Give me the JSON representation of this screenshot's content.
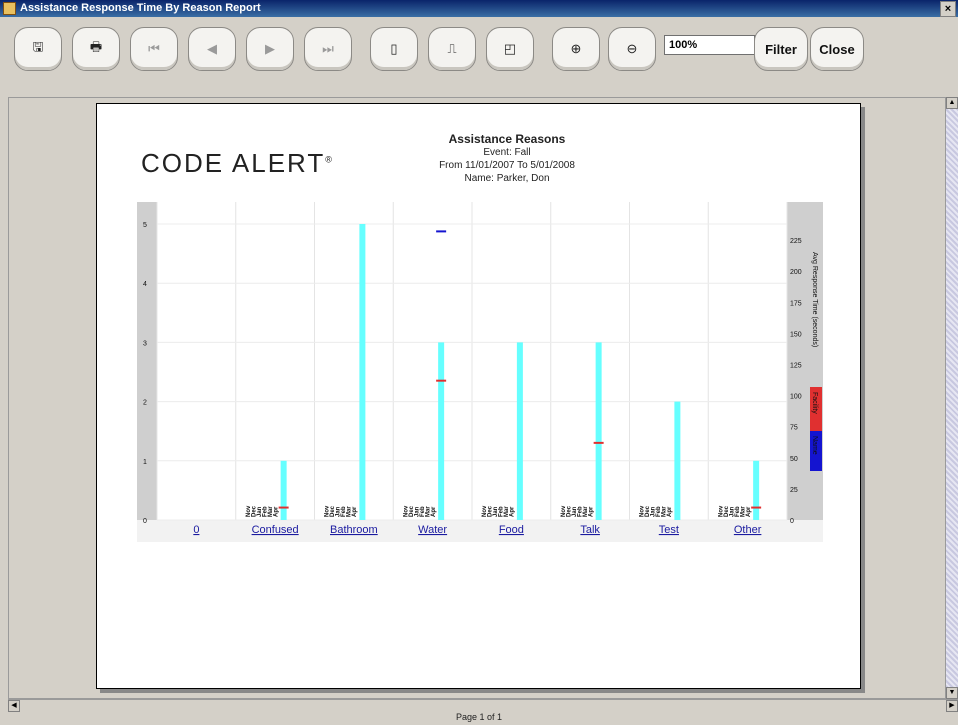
{
  "window": {
    "title": "Assistance Response Time By Reason Report",
    "close_glyph": "×"
  },
  "toolbar": {
    "buttons": [
      {
        "icon": "save-icon",
        "glyph": "🖫"
      },
      {
        "icon": "print-icon",
        "glyph": "🖶"
      },
      {
        "icon": "first-page-icon",
        "glyph": "⏮"
      },
      {
        "icon": "previous-page-icon",
        "glyph": "◀"
      },
      {
        "icon": "next-page-icon",
        "glyph": "▶"
      },
      {
        "icon": "last-page-icon",
        "glyph": "⏭"
      },
      {
        "icon": "actual-size-icon",
        "glyph": "▯"
      },
      {
        "icon": "fit-width-icon",
        "glyph": "⎍"
      },
      {
        "icon": "fit-page-icon",
        "glyph": "◰"
      },
      {
        "icon": "zoom-in-icon",
        "glyph": "⊕"
      },
      {
        "icon": "zoom-out-icon",
        "glyph": "⊖"
      }
    ],
    "zoom_value": "100%",
    "filter_label": "Filter",
    "close_label": "Close"
  },
  "report": {
    "logo": "CODE ALERT",
    "logo_mark": "®",
    "title": "Assistance Reasons",
    "event": "Event: Fall",
    "range": "From 11/01/2007 To 5/01/2008",
    "name": "Name: Parker, Don"
  },
  "chart_data": {
    "type": "bar",
    "categories": [
      "0",
      "Confused",
      "Bathroom",
      "Water",
      "Food",
      "Talk",
      "Test",
      "Other"
    ],
    "month_labels": [
      "Nov",
      "Dec",
      "Jan",
      "Feb",
      "Mar",
      "Apr"
    ],
    "count_axis": {
      "ticks": [
        "0",
        "1",
        "2",
        "3",
        "4",
        "5"
      ],
      "ylim": [
        0,
        5
      ]
    },
    "time_axis": {
      "label": "Avg Response Time (seconds)",
      "ticks": [
        "0",
        "25",
        "50",
        "75",
        "100",
        "125",
        "150",
        "175",
        "200",
        "225"
      ],
      "ylim": [
        0,
        250
      ]
    },
    "legend": [
      {
        "label": "Facility",
        "color": "#e03030"
      },
      {
        "label": "Name",
        "color": "#1414d0"
      }
    ],
    "bar_color": "#66ffff",
    "counts": [
      0,
      1,
      5,
      3,
      3,
      3,
      2,
      1
    ],
    "facility_avg": [
      null,
      10,
      null,
      112,
      null,
      62,
      null,
      10
    ],
    "name_avg": [
      null,
      null,
      null,
      232,
      null,
      null,
      null,
      null
    ]
  },
  "status": {
    "page": "Page 1 of 1"
  }
}
